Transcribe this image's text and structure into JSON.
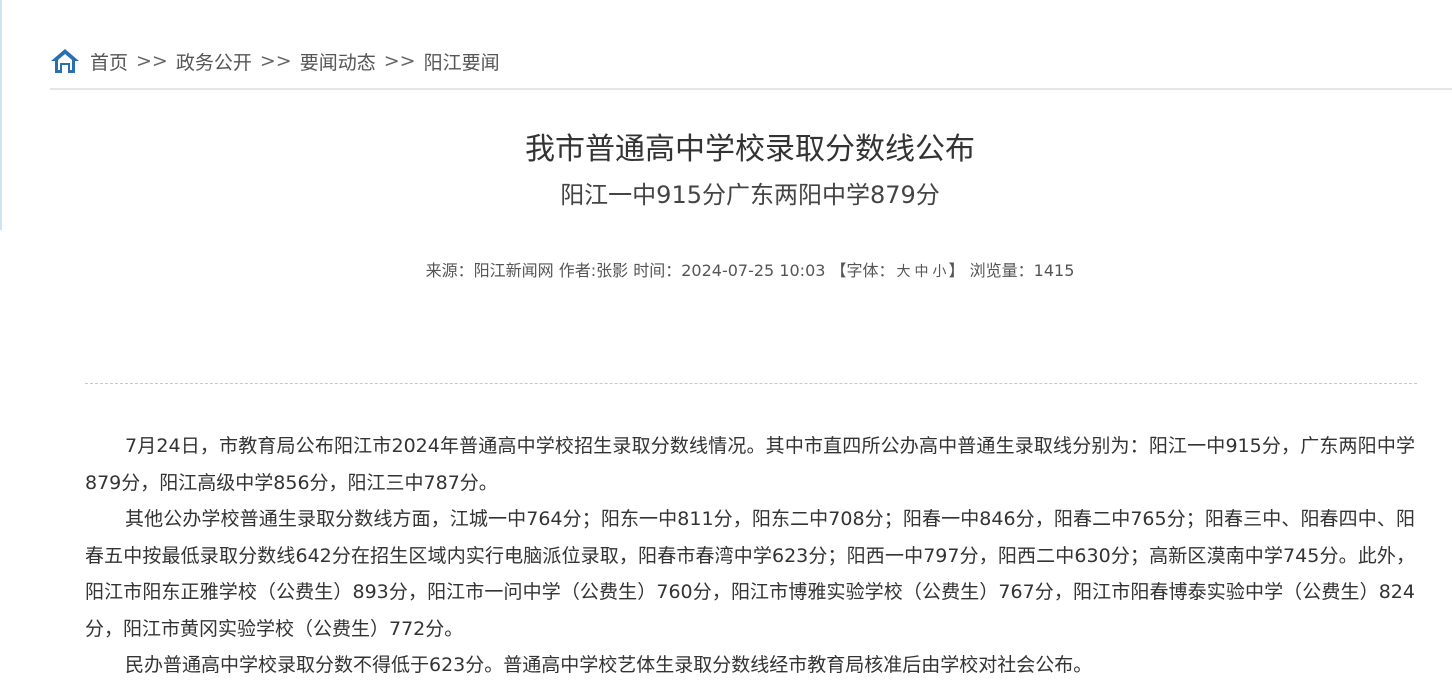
{
  "breadcrumb": {
    "home": "首页",
    "sep": ">>",
    "items": [
      "政务公开",
      "要闻动态",
      "阳江要闻"
    ],
    "icon": "home-icon",
    "icon_color": "#2a6fb0"
  },
  "article": {
    "title": "我市普通高中学校录取分数线公布",
    "subtitle": "阳江一中915分广东两阳中学879分",
    "meta": {
      "source_label": "来源：",
      "source": "阳江新闻网",
      "author_label": "作者:",
      "author": "张影",
      "time_label": "时间：",
      "time": "2024-07-25 10:03",
      "font_open": "【字体：",
      "font_large": "大",
      "font_medium": "中",
      "font_small": "小",
      "font_close": "】",
      "views_label": "浏览量：",
      "views": "1415"
    },
    "paragraphs": [
      "7月24日，市教育局公布阳江市2024年普通高中学校招生录取分数线情况。其中市直四所公办高中普通生录取线分别为：阳江一中915分，广东两阳中学879分，阳江高级中学856分，阳江三中787分。",
      "其他公办学校普通生录取分数线方面，江城一中764分；阳东一中811分，阳东二中708分；阳春一中846分，阳春二中765分；阳春三中、阳春四中、阳春五中按最低录取分数线642分在招生区域内实行电脑派位录取，阳春市春湾中学623分；阳西一中797分，阳西二中630分；高新区漠南中学745分。此外，阳江市阳东正雅学校（公费生）893分，阳江市一问中学（公费生）760分，阳江市博雅实验学校（公费生）767分，阳江市阳春博泰实验中学（公费生）824分，阳江市黄冈实验学校（公费生）772分。",
      "民办普通高中学校录取分数不得低于623分。普通高中学校艺体生录取分数线经市教育局核准后由学校对社会公布。"
    ]
  }
}
